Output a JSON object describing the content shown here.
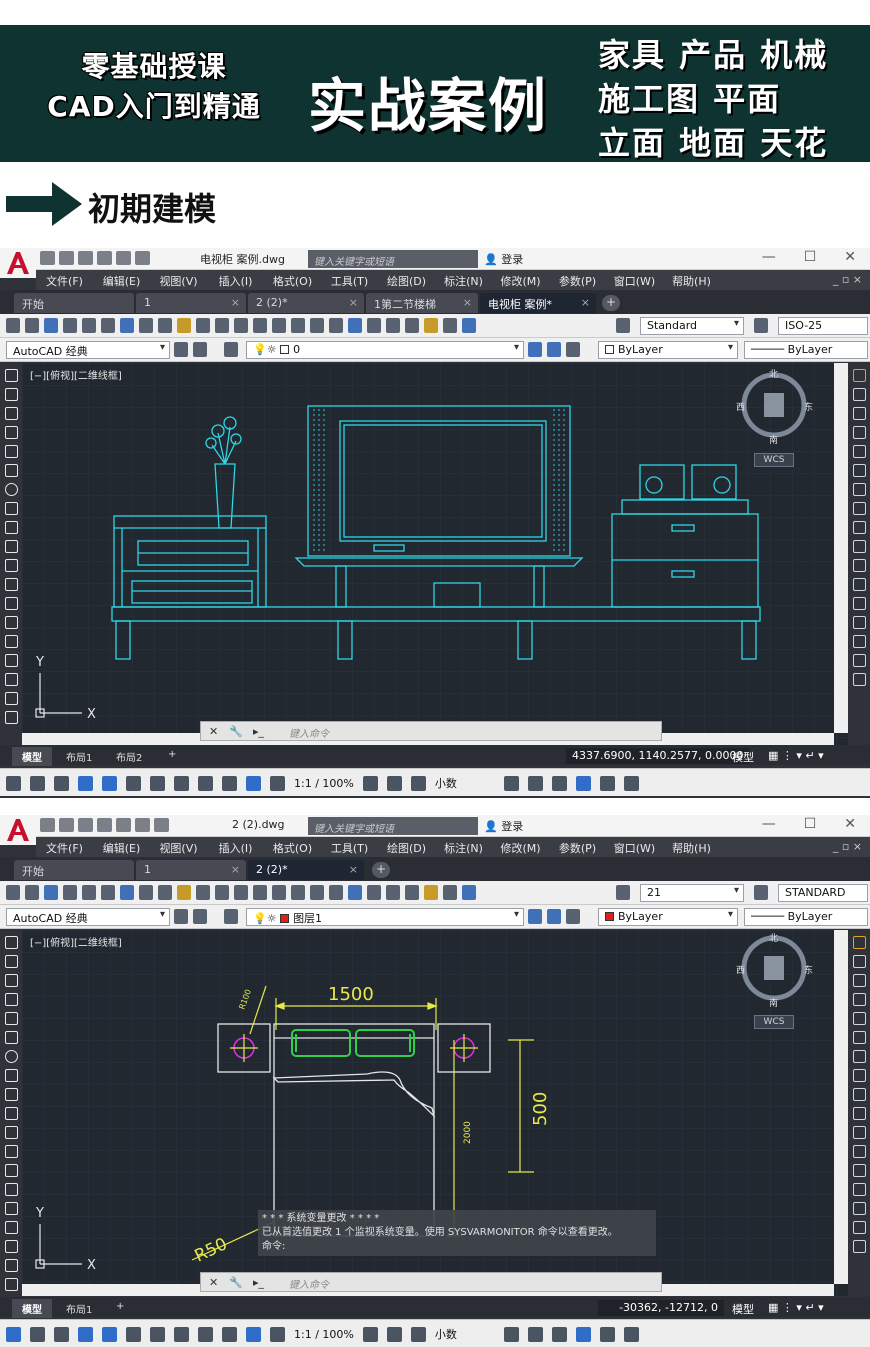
{
  "banner": {
    "left_line1": "零基础授课",
    "left_line2": "CAD入门到精通",
    "center": "实战案例",
    "right_lines": [
      "家具  产品  机械",
      "施工图  平面",
      "立面  地面  天花"
    ]
  },
  "section": {
    "title": "初期建模"
  },
  "window1": {
    "doc_title": "电视柜 案例.dwg",
    "search_placeholder": "键入关键字或短语",
    "login": "登录",
    "menus": [
      "文件(F)",
      "编辑(E)",
      "视图(V)",
      "插入(I)",
      "格式(O)",
      "工具(T)",
      "绘图(D)",
      "标注(N)",
      "修改(M)",
      "参数(P)",
      "窗口(W)",
      "帮助(H)"
    ],
    "tabs": [
      "开始",
      "1",
      "2 (2)*",
      "1第二节楼梯",
      "电视柜 案例*"
    ],
    "text_style": "Standard",
    "dim_style": "ISO-25",
    "workspace": "AutoCAD 经典",
    "layer": "0",
    "color": "ByLayer",
    "linetype": "ByLayer",
    "viewport_label": "[−][俯视][二维线框]",
    "wcs": "WCS",
    "compass": {
      "n": "北",
      "s": "南",
      "e": "东",
      "w": "西"
    },
    "cmd_placeholder": "键入命令",
    "layout_tabs": [
      "模型",
      "布局1",
      "布局2"
    ],
    "coords": "4337.6900, 1140.2577, 0.0000",
    "model_label": "模型",
    "scale": "1:1 / 100%",
    "units": "小数"
  },
  "window2": {
    "doc_title": "2 (2).dwg",
    "search_placeholder": "键入关键字或短语",
    "login": "登录",
    "menus": [
      "文件(F)",
      "编辑(E)",
      "视图(V)",
      "插入(I)",
      "格式(O)",
      "工具(T)",
      "绘图(D)",
      "标注(N)",
      "修改(M)",
      "参数(P)",
      "窗口(W)",
      "帮助(H)"
    ],
    "tabs": [
      "开始",
      "1",
      "2 (2)*"
    ],
    "text_style": "21",
    "dim_style": "STANDARD",
    "workspace": "AutoCAD 经典",
    "layer": "图层1",
    "color": "ByLayer",
    "linetype": "ByLayer",
    "viewport_label": "[−][俯视][二维线框]",
    "wcs": "WCS",
    "compass": {
      "n": "北",
      "s": "南",
      "e": "东",
      "w": "西"
    },
    "dims": {
      "width": "1500",
      "height_small": "2000",
      "side": "500",
      "radius": "R50",
      "radius_small": "R100"
    },
    "sysmsg_title": "* * * 系统变量更改 * * * *",
    "sysmsg_body": "已从首选值更改 1 个监视系统变量。使用 SYSVARMONITOR 命令以查看更改。",
    "cmd_prompt": "命令:",
    "cmd_placeholder": "键入命令",
    "layout_tabs": [
      "模型",
      "布局1"
    ],
    "coords": "-30362, -12712, 0",
    "model_label": "模型",
    "scale": "1:1 / 100%",
    "units": "小数"
  },
  "colors": {
    "banner_bg": "#0e3330",
    "cad_bg": "#212830",
    "cyan": "#2fd6e6",
    "yellow": "#e8e84a",
    "green": "#2fd04a",
    "magenta": "#e02fe0"
  }
}
